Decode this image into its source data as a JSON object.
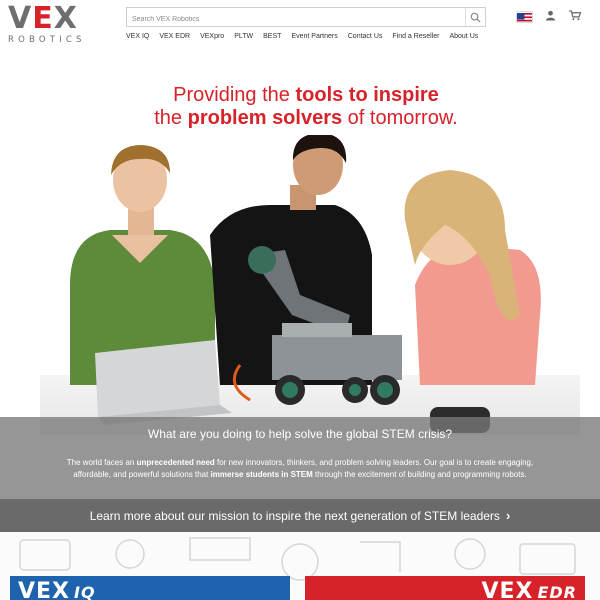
{
  "brand": {
    "logo_main": "VEX",
    "logo_sub": "ROBOTICS"
  },
  "search": {
    "placeholder": "Search VEX Robotics"
  },
  "icons": {
    "search": "search-icon",
    "flag": "us-flag-icon",
    "account": "user-icon",
    "cart": "cart-icon"
  },
  "nav": [
    "VEX IQ",
    "VEX EDR",
    "VEXpro",
    "PLTW",
    "BEST",
    "Event Partners",
    "Contact Us",
    "Find a Reseller",
    "About Us"
  ],
  "hero": {
    "line1_pre": "Providing the ",
    "line1_bold": "tools to inspire",
    "line2_pre": "the ",
    "line2_bold": "problem solvers",
    "line2_post": " of tomorrow."
  },
  "stem": {
    "question": "What are you doing to help solve the global STEM crisis?",
    "body_1": "The world faces an ",
    "body_bold_1": "unprecedented need",
    "body_2": " for new innovators, thinkers, and problem solving leaders. Our goal is to create engaging, affordable, and powerful solutions that ",
    "body_bold_2": "immerse students in STEM",
    "body_3": " through the excitement of building and programming robots."
  },
  "learn_more": {
    "label": "Learn more about our mission to inspire the next generation of STEM leaders"
  },
  "cards": {
    "iq_main": "VEX",
    "iq_sub": "IQ",
    "edr_main": "VEX",
    "edr_sub": "EDR"
  },
  "colors": {
    "accent": "#d8222a",
    "iq_blue": "#1d63ad",
    "gray_band": "#787878",
    "dark_band": "#555555"
  }
}
